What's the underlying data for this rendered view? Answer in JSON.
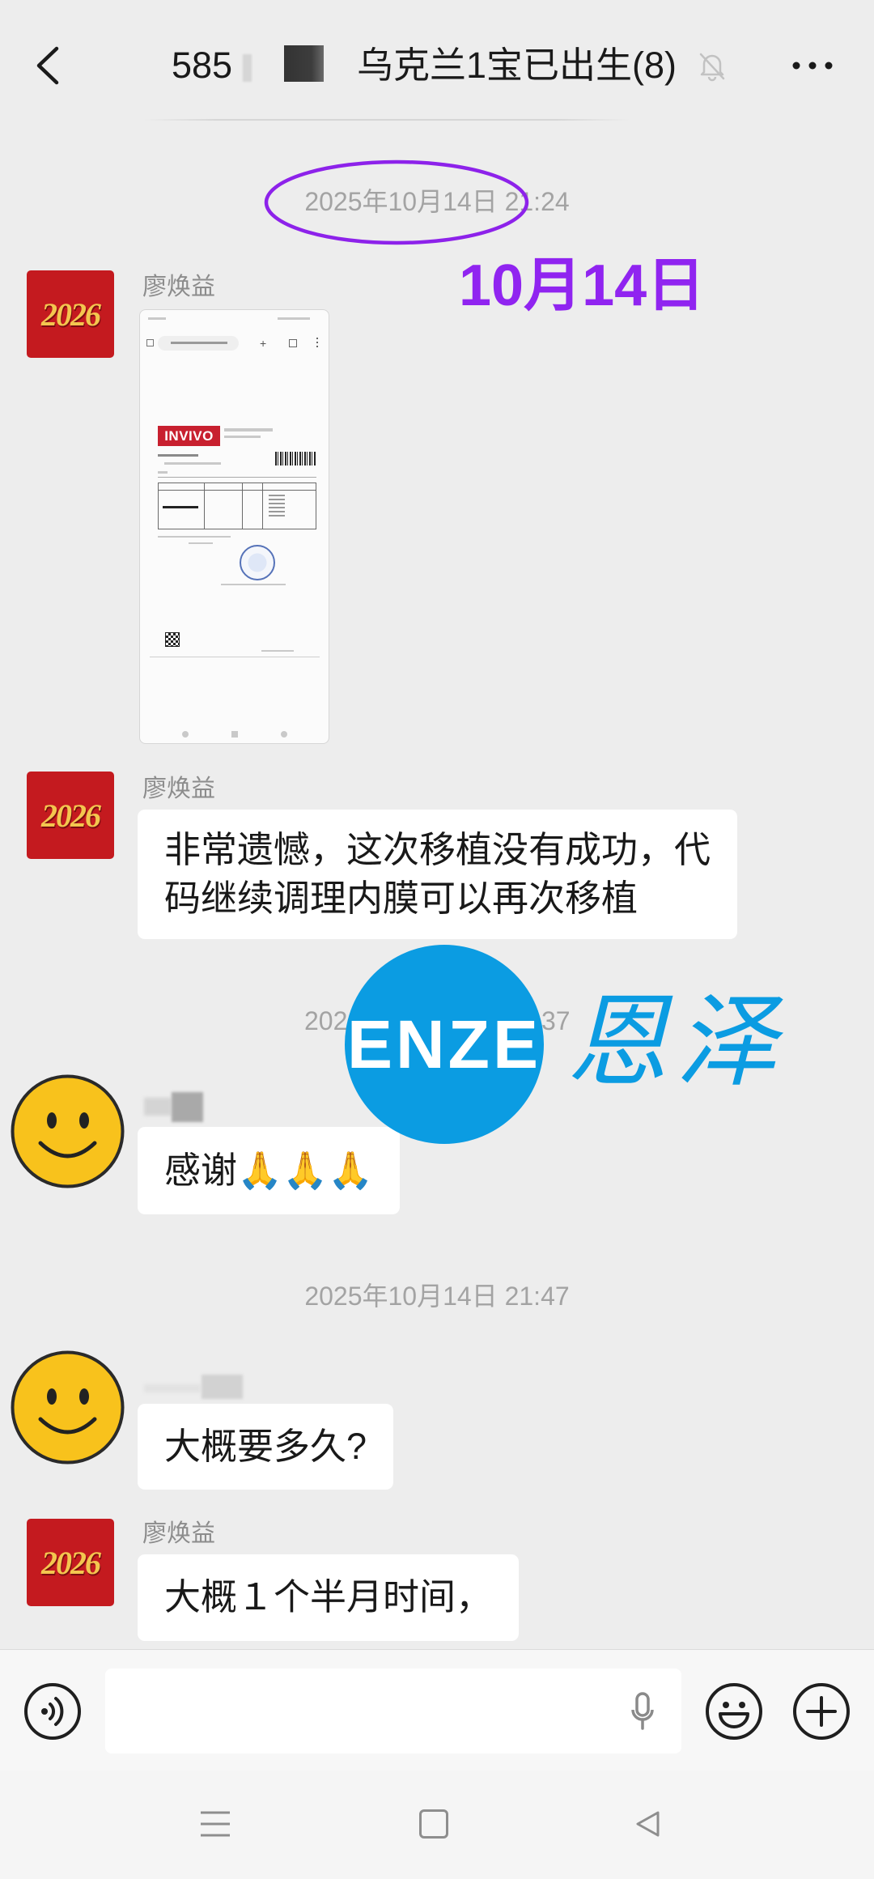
{
  "colors": {
    "chat_background": "#ededed",
    "bubble": "#ffffff",
    "annotation_purple": "#9024f0",
    "watermark_blue": "#0b9ce2",
    "avatar_red": "#c41a1f",
    "avatar_gold": "#f3c64f",
    "smiley_yellow": "#f8c21c"
  },
  "header": {
    "back_icon": "chevron-left-icon",
    "title_prefix": "585",
    "title_suffix": "乌克兰1宝已出生(8)",
    "mute_icon": "bell-muted-icon",
    "more_icon": "more-dots-icon"
  },
  "timestamps": {
    "t1": "2025年10月14日 21:24",
    "t2_left": "202",
    "t2_right": "37",
    "t3": "2025年10月14日 21:47"
  },
  "annotation": {
    "label": "10月14日"
  },
  "messages": [
    {
      "sender": "廖焕益",
      "avatar_text": "2026",
      "type": "image",
      "image": {
        "brand": "INVIVO"
      }
    },
    {
      "sender": "廖焕益",
      "avatar_text": "2026",
      "type": "text",
      "lines": [
        "非常遗憾，这次移植没有成功，代",
        "码继续调理内膜可以再次移植"
      ]
    },
    {
      "avatar": "smiley-avatar",
      "type": "text",
      "lines": [
        "感谢🙏🙏🙏"
      ]
    },
    {
      "avatar": "smiley-avatar",
      "type": "text",
      "lines": [
        "大概要多久?"
      ]
    },
    {
      "sender": "廖焕益",
      "avatar_text": "2026",
      "type": "text",
      "lines": [
        "大概１个半月时间，"
      ]
    }
  ],
  "watermark": {
    "logo_text": "ENZE",
    "brand_text": "恩泽"
  },
  "input_bar": {
    "voice_icon": "voice-icon",
    "value": "",
    "mic_icon": "mic-icon",
    "emoji_icon": "emoji-icon",
    "plus_icon": "plus-icon"
  },
  "nav_bar": {
    "icons": [
      "menu-icon",
      "home-square-icon",
      "back-triangle-icon"
    ]
  }
}
